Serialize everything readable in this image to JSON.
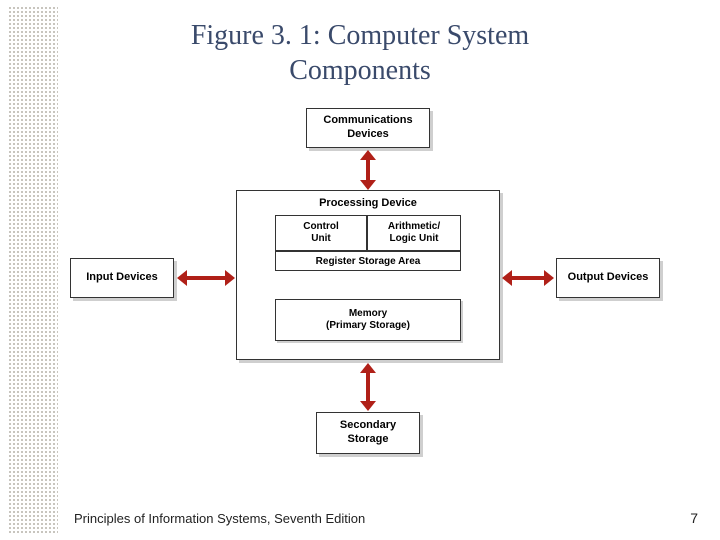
{
  "title_line1": "Figure 3. 1: Computer System",
  "title_line2": "Components",
  "boxes": {
    "comm_l1": "Communications",
    "comm_l2": "Devices",
    "input": "Input Devices",
    "output": "Output Devices",
    "proc_title": "Processing Device",
    "control_l1": "Control",
    "control_l2": "Unit",
    "alu_l1": "Arithmetic/",
    "alu_l2": "Logic Unit",
    "register": "Register Storage Area",
    "mem_l1": "Memory",
    "mem_l2": "(Primary Storage)",
    "sec_l1": "Secondary",
    "sec_l2": "Storage"
  },
  "footer": {
    "left": "Principles of Information Systems, Seventh Edition",
    "page": "7"
  }
}
